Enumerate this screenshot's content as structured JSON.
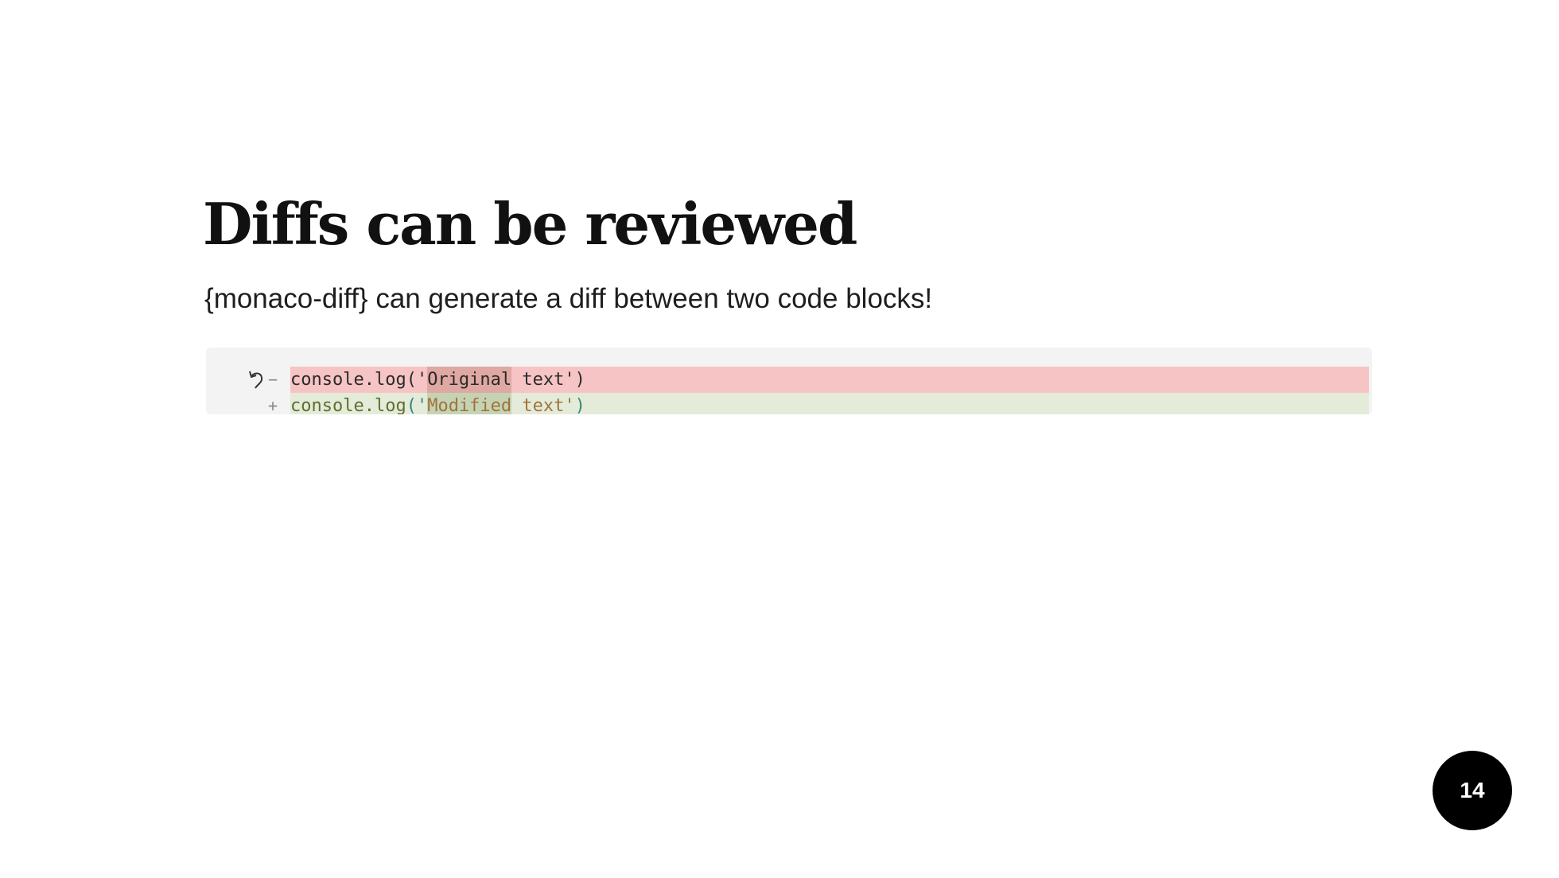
{
  "slide": {
    "title": "Diffs can be reviewed",
    "subtitle": "{monaco-diff} can generate a diff between two code blocks!",
    "page_number": "14"
  },
  "diff_editor": {
    "removed_line": {
      "marker": "−",
      "prefix": "console.log('",
      "changed": "Original",
      "suffix": " text')"
    },
    "added_line": {
      "marker": "+",
      "prefix_ident": "console.log",
      "prefix_punc": "('",
      "changed": "Modified",
      "suffix_text": " text'",
      "suffix_punc": ")"
    },
    "icons": {
      "revert": "undo-arrow-icon"
    }
  },
  "colors": {
    "removed_line_bg": "#f6c4c4",
    "removed_word_bg": "#dfa8a2",
    "added_line_bg": "#e4ebd8",
    "added_word_bg": "#c5d3b5",
    "editor_bg": "#f3f3f3",
    "badge_bg": "#000000"
  }
}
